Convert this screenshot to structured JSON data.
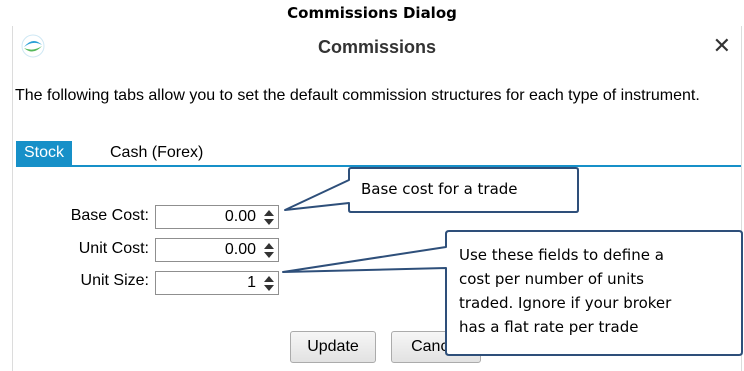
{
  "caption": "Commissions Dialog",
  "dialog": {
    "title": "Commissions",
    "close_icon": "close-icon",
    "app_icon": "app-logo-icon",
    "description": "The following tabs allow you to set the default commission structures for each type of instrument.",
    "tabs": [
      {
        "label": "Stock",
        "active": true
      },
      {
        "label": "Cash (Forex)",
        "active": false
      }
    ],
    "fields": [
      {
        "label": "Base Cost:",
        "value": "0.00"
      },
      {
        "label": "Unit Cost:",
        "value": "0.00"
      },
      {
        "label": "Unit Size:",
        "value": "1"
      }
    ],
    "buttons": {
      "update": "Update",
      "cancel": "Cancel"
    }
  },
  "callouts": {
    "base": "Base cost for a trade",
    "units": [
      "Use these fields to define a",
      "cost per number of units",
      "traded.  Ignore if your broker",
      "has a flat rate per trade"
    ]
  },
  "colors": {
    "accent": "#1790c8",
    "callout_border": "#2e4f7a"
  }
}
